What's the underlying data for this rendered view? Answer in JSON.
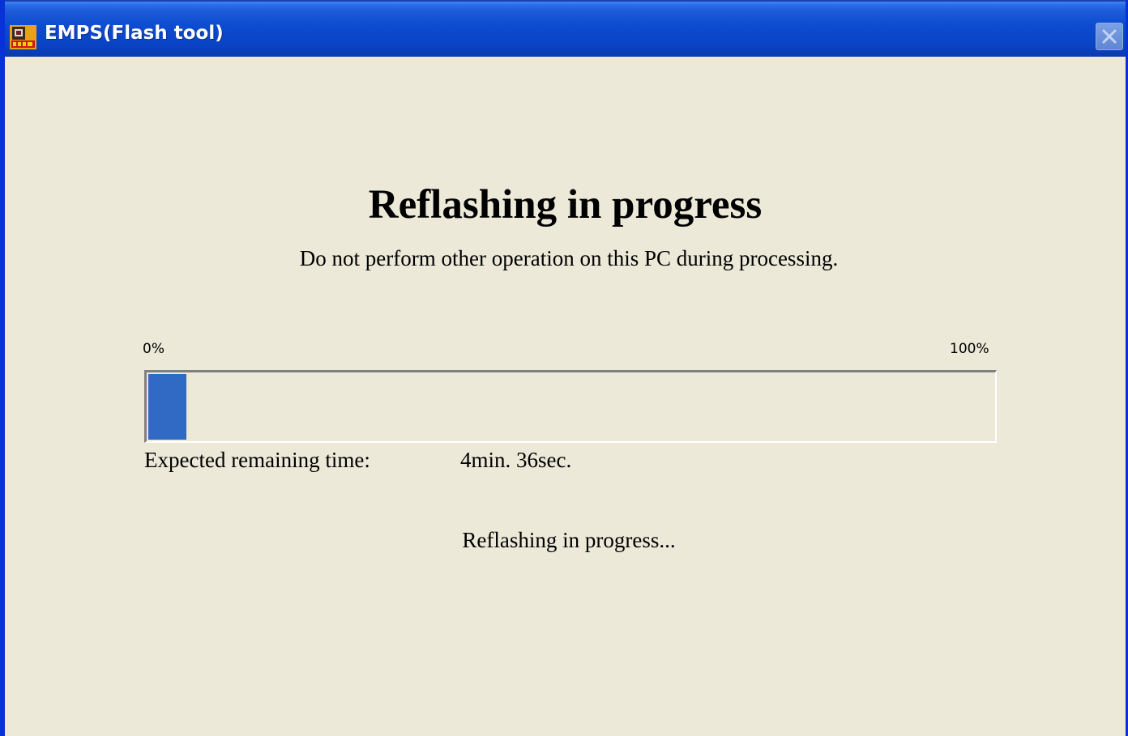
{
  "window": {
    "title": "EMPS(Flash tool)",
    "icon": "emps-app-icon",
    "close_icon": "close-icon"
  },
  "main": {
    "heading": "Reflashing in progress",
    "subheading": "Do not perform other operation on this PC during processing.",
    "progress": {
      "min_label": "0%",
      "max_label": "100%",
      "value_fraction": 0.045,
      "fill_color": "#316ac5"
    },
    "remaining_label": "Expected remaining time:",
    "remaining_value": "4min. 36sec.",
    "status": "Reflashing in progress..."
  },
  "colors": {
    "titlebar": "#0a44c6",
    "background": "#ece9d8"
  }
}
